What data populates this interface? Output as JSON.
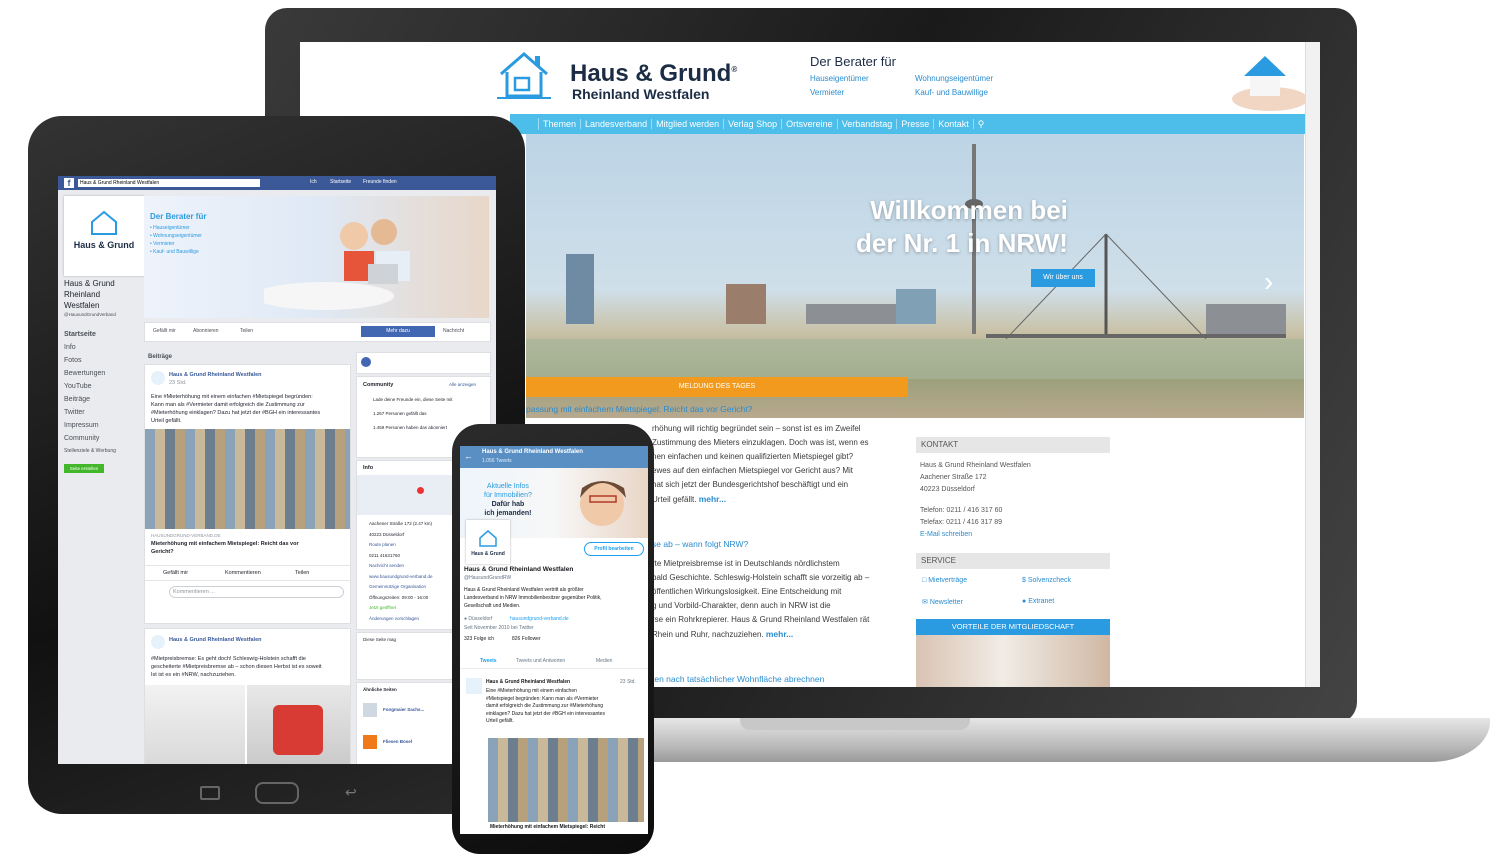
{
  "laptop": {
    "logo": {
      "line1": "Haus & Grund",
      "reg": "®",
      "line2": "Rheinland Westfalen"
    },
    "tagline": {
      "title": "Der Berater für",
      "col1": [
        "Hauseigentümer",
        "Vermieter"
      ],
      "col2": [
        "Wohnungseigentümer",
        "Kauf- und Bauwillige"
      ]
    },
    "nav": [
      "Themen",
      "Landesverband",
      "Mitglied werden",
      "Verlag Shop",
      "Ortsvereine",
      "Verbandstag",
      "Presse",
      "Kontakt"
    ],
    "hero": {
      "title_line1": "Willkommen bei",
      "title_line2": "der Nr. 1 in NRW!",
      "button": "Wir über uns",
      "arrow": "›"
    },
    "news": {
      "bar": "MELDUNG DES TAGES",
      "headline1": "passung mit einfachem Mietspiegel: Reicht das vor Gericht?",
      "body1": [
        "rhöhung will richtig begründet sein – sonst ist es im Zweifel",
        "Zustimmung des Mieters einzuklagen. Doch was ist, wenn es",
        "nen einfachen und keinen qualifizierten Mietspiegel gibt?",
        "ewes auf den einfachen Mietspiegel vor Gericht aus? Mit",
        "hat sich jetzt der Bundesgerichtshof beschäftigt und ein",
        "Urteil gefällt."
      ],
      "more1": "mehr...",
      "headline2": "se ab – wann folgt NRW?",
      "body2": [
        "rte Mietpreisbremse ist in Deutschlands nördlichstem",
        "bald Geschichte. Schleswig-Holstein schafft sie vorzeitig ab –",
        "öffentlichen Wirkungslosigkeit. Eine Entscheidung mit",
        "g und Vorbild-Charakter, denn auch in NRW ist die",
        "rse ein Rohrkrepierer. Haus & Grund Rheinland Westfalen rät",
        "Rhein und Ruhr, nachzuziehen."
      ],
      "more2": "mehr...",
      "headline3": "ten nach tatsächlicher Wohnfläche abrechnen"
    },
    "sidebar": {
      "kontakt_title": "KONTAKT",
      "address": [
        "Haus & Grund Rheinland Westfalen",
        "Aachener Straße 172",
        "40223 Düsseldorf"
      ],
      "phone": "Telefon: 0211 / 416 317 60",
      "fax": "Telefax: 0211 / 416 317 89",
      "email": "E-Mail schreiben",
      "service_title": "SERVICE",
      "service": [
        "Mietverträge",
        "Solvenzcheck",
        "Newsletter",
        "Extranet"
      ],
      "vorteile": "VORTEILE DER MITGLIEDSCHAFT"
    }
  },
  "tablet": {
    "search": "Haus & Grund Rheinland Westfalen",
    "top_links": [
      "Ich",
      "Startseite",
      "Freunde finden"
    ],
    "cover_title": "Der Berater für",
    "cover_items": [
      "• Hauseigentümer",
      "• Wohnungseigentümer",
      "• Vermieter",
      "• Kauf- und Bauwillige"
    ],
    "page_name": [
      "Haus & Grund",
      "Rheinland",
      "Westfalen"
    ],
    "handle": "@HausundGrundVerband",
    "side_menu": [
      "Startseite",
      "Info",
      "Fotos",
      "Bewertungen",
      "YouTube",
      "Beiträge",
      "Twitter",
      "Impressum",
      "Community",
      "Stellenziele & Werbung"
    ],
    "create_btn": "Seite erstellen",
    "actions": [
      "Gefällt mir",
      "Abonnieren",
      "Teilen",
      "Mehr dazu",
      "Nachricht"
    ],
    "beitraege": "Beiträge",
    "post_author": "Haus & Grund Rheinland Westfalen",
    "post_time": "23 Std.",
    "post_lines": [
      "Eine #Mieterhöhung mit einem einfachen #Mietspiegel begründen:",
      "Kann man als #Vermieter damit erfolgreich die Zustimmung zur",
      "#Mieterhöhung einklagen? Dazu hat jetzt der #BGH ein interessantes",
      "Urteil gefällt."
    ],
    "post_source": "HAUSUNDGRUND-VERBAND.DE",
    "post_headline": "Mieterhöhung mit einfachem Mietspiegel: Reicht das vor",
    "post_headline2": "Gericht?",
    "reactions": [
      "Gefällt mir",
      "Kommentieren",
      "Teilen"
    ],
    "comment_placeholder": "Kommentieren ...",
    "post2_author": "Haus & Grund Rheinland Westfalen",
    "post2_lines": [
      "#Mietpreisbremse: Es geht doch! Schleswig-Holstein schafft die",
      "gescheiterte #Mietpreisbremse ab – schon diesen Herbst ist es soweit",
      "Ist ist es ein #NRW, nachzuziehen."
    ],
    "community": "Community",
    "community_more": "Alle anzeigen",
    "community_lines": [
      "Lade deine Freunde ein, diese Seite mit",
      "1.267 Personen gefällt das",
      "1.459 Personen haben das abonniert"
    ],
    "info": "Info",
    "info_lines": [
      "Aachener Straße 172 (2.47 km)",
      "40223 Düsseldorf",
      "Route planen",
      "0211 41631760",
      "Nachricht senden",
      "www.hausundgrund-verband.de",
      "Gemeinnützige Organisation",
      "Öffnungszeiten: 09:00 - 16:00",
      "Jetzt geöffnet",
      "Änderungen vorschlagen"
    ],
    "pages_liked": "Diese Seite mag",
    "related": "Ähnliche Seiten",
    "related_items": [
      "Fongmaier Sachs...",
      "Fliesen Bosel"
    ]
  },
  "phone": {
    "header_name": "Haus & Grund Rheinland Westfalen",
    "header_tweets": "1.056 Tweets",
    "banner_lines": [
      "Aktuelle Infos",
      "für Immobilien?",
      "Dafür hab",
      "ich jemanden!"
    ],
    "edit_profile": "Profil bearbeiten",
    "name": "Haus & Grund Rheinland Westfalen",
    "handle": "@HausundGrundRW",
    "bio": [
      "Haus & Grund Rheinland Westfalen vertritt als größter",
      "Landesverband in NRW Immobilienbesitzer gegenüber Politik,",
      "Gesellschaft und Medien."
    ],
    "location": "Düsseldorf",
    "website": "hausundgrund-verband.de",
    "joined": "Seit November 2010 bei Twitter",
    "following": "323 Folge ich",
    "followers": "826 Follower",
    "tabs": [
      "Tweets",
      "Tweets und Antworten",
      "Medien"
    ],
    "tweet_author": "Haus & Grund Rheinland Westfalen",
    "tweet_time": "23 Std.",
    "tweet_lines": [
      "Eine #Mieterhöhung mit einem einfachen",
      "#Mietspiegel begründen: Kann man als #Vermieter",
      "damit erfolgreich die Zustimmung zur #Mieterhöhung",
      "einklagen? Dazu hat jetzt der #BGH ein interessantes",
      "Urteil gefällt."
    ],
    "tweet_caption": "Mieterhöhung mit einfachem Mietspiegel: Reicht"
  }
}
